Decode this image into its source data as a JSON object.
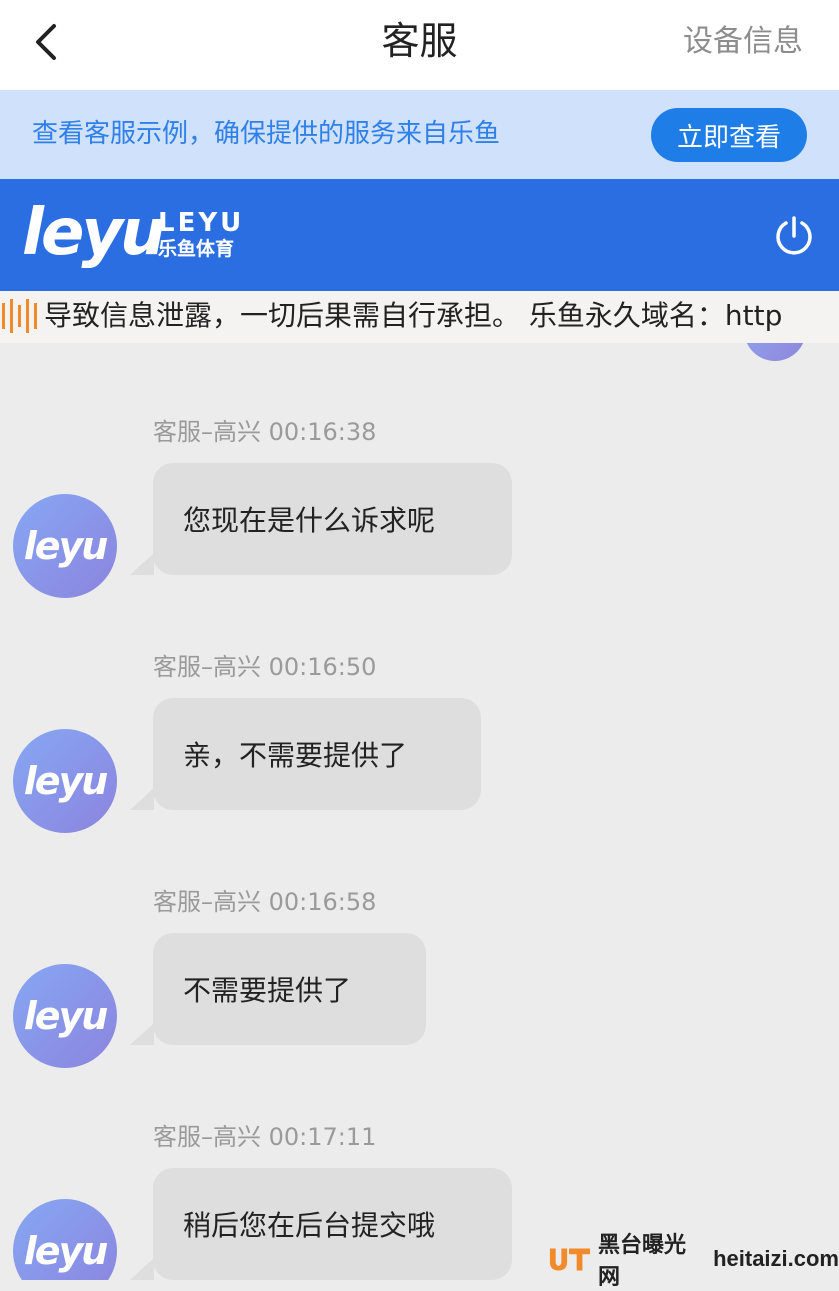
{
  "nav": {
    "title": "客服",
    "right_label": "设备信息"
  },
  "notice": {
    "text": "查看客服示例，确保提供的服务来自乐鱼",
    "button_label": "立即查看"
  },
  "brand": {
    "logo_word": "leyu",
    "logo_sub_en": "LEYU",
    "logo_sub_cn": "乐鱼体育"
  },
  "marquee": {
    "text": "导致信息泄露，一切后果需自行承担。 乐鱼永久域名：http"
  },
  "messages": [
    {
      "sender": "客服–高兴",
      "time": "00:16:38",
      "text": "您现在是什么诉求呢"
    },
    {
      "sender": "客服–高兴",
      "time": "00:16:50",
      "text": "亲，不需要提供了"
    },
    {
      "sender": "客服–高兴",
      "time": "00:16:58",
      "text": "不需要提供了"
    },
    {
      "sender": "客服–高兴",
      "time": "00:17:11",
      "text": "稍后您在后台提交哦"
    }
  ],
  "avatar_text": "leyu",
  "watermark": {
    "cn": "黑台曝光网",
    "domain": "heitaizi.com"
  },
  "colors": {
    "brand_blue": "#2b6ee2",
    "notice_bg": "#cfe1fb",
    "notice_text": "#2f80e8",
    "bubble_bg": "#dedede",
    "chat_bg": "#ececec"
  }
}
